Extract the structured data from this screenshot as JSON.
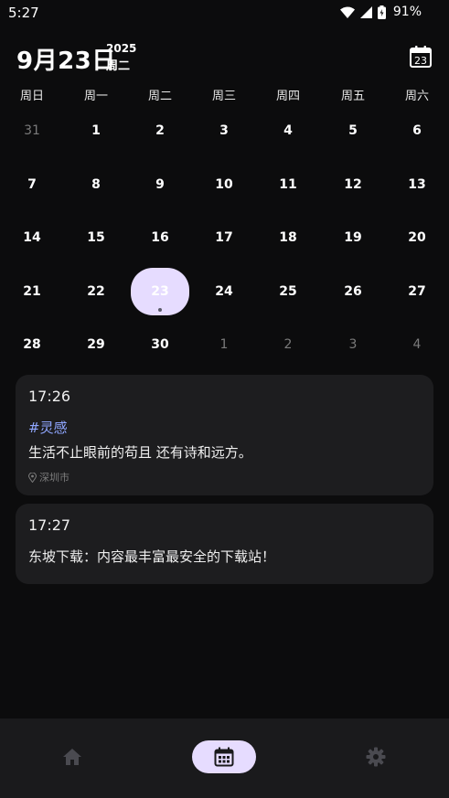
{
  "status_bar": {
    "time": "5:27",
    "battery": "91%"
  },
  "header": {
    "date": "9月23日",
    "year": "2025",
    "weekday": "周二",
    "calendar_icon_day": "23"
  },
  "weekdays": [
    "周日",
    "周一",
    "周二",
    "周三",
    "周四",
    "周五",
    "周六"
  ],
  "calendar": {
    "weeks": [
      [
        {
          "d": "31",
          "muted": true
        },
        {
          "d": "1"
        },
        {
          "d": "2"
        },
        {
          "d": "3"
        },
        {
          "d": "4"
        },
        {
          "d": "5"
        },
        {
          "d": "6"
        }
      ],
      [
        {
          "d": "7"
        },
        {
          "d": "8"
        },
        {
          "d": "9"
        },
        {
          "d": "10"
        },
        {
          "d": "11"
        },
        {
          "d": "12"
        },
        {
          "d": "13"
        }
      ],
      [
        {
          "d": "14"
        },
        {
          "d": "15"
        },
        {
          "d": "16"
        },
        {
          "d": "17"
        },
        {
          "d": "18"
        },
        {
          "d": "19"
        },
        {
          "d": "20"
        }
      ],
      [
        {
          "d": "21"
        },
        {
          "d": "22"
        },
        {
          "d": "23",
          "selected": true,
          "has_note": true
        },
        {
          "d": "24"
        },
        {
          "d": "25"
        },
        {
          "d": "26"
        },
        {
          "d": "27"
        }
      ],
      [
        {
          "d": "28"
        },
        {
          "d": "29"
        },
        {
          "d": "30"
        },
        {
          "d": "1",
          "muted": true
        },
        {
          "d": "2",
          "muted": true
        },
        {
          "d": "3",
          "muted": true
        },
        {
          "d": "4",
          "muted": true
        }
      ]
    ]
  },
  "notes": [
    {
      "time": "17:26",
      "tag": "#灵感",
      "text": "生活不止眼前的苟且 还有诗和远方。",
      "location": "深圳市"
    },
    {
      "time": "17:27",
      "text": "东坡下载：内容最丰富最安全的下载站！"
    }
  ],
  "nav": {
    "home_icon": "home-icon",
    "calendar_icon": "calendar-icon",
    "settings_icon": "gear-icon"
  },
  "colors": {
    "accent": "#e6dcff",
    "tag": "#8fa6ff",
    "card": "#1d1d1f",
    "background": "#0c0c0d"
  }
}
